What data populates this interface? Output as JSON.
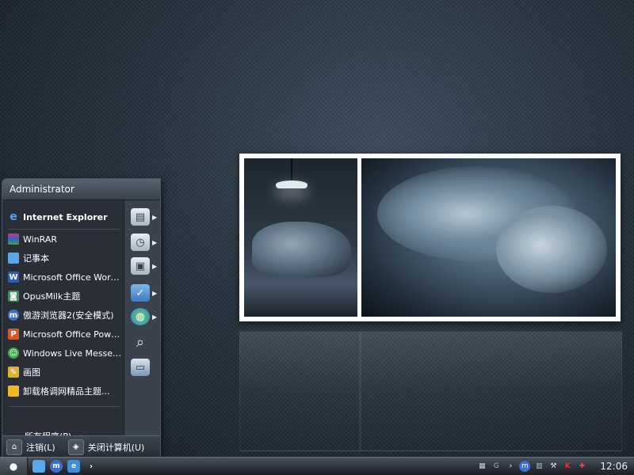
{
  "start_menu": {
    "user_name": "Administrator",
    "programs": [
      {
        "label": "Internet Explorer",
        "icon": "internet-explorer-icon",
        "bold": true
      },
      {
        "label": "WinRAR",
        "icon": "winrar-icon"
      },
      {
        "label": "记事本",
        "icon": "notepad-icon"
      },
      {
        "label": "Microsoft Office Word ...",
        "icon": "word-icon"
      },
      {
        "label": "OpusMilk主题",
        "icon": "opusmilk-icon"
      },
      {
        "label": "傲游浏览器2(安全模式)",
        "icon": "maxthon-icon"
      },
      {
        "label": "Microsoft Office Power...",
        "icon": "powerpoint-icon"
      },
      {
        "label": "Windows Live Messeng...",
        "icon": "messenger-icon"
      },
      {
        "label": "画图",
        "icon": "paint-icon"
      },
      {
        "label": "卸载格调网精品主题...",
        "icon": "uninstall-icon"
      }
    ],
    "all_programs_label": "所有程序(P)",
    "right_items": [
      {
        "icon": "my-documents-icon",
        "has_submenu": true
      },
      {
        "icon": "recent-documents-icon",
        "has_submenu": true
      },
      {
        "icon": "my-pictures-icon",
        "has_submenu": true
      },
      {
        "icon": "control-panel-icon",
        "has_submenu": true
      },
      {
        "icon": "network-icon",
        "has_submenu": true
      },
      {
        "icon": "search-icon",
        "has_submenu": false
      },
      {
        "icon": "run-icon",
        "has_submenu": false
      }
    ],
    "logoff_label": "注销(L)",
    "shutdown_label": "关闭计算机(U)"
  },
  "taskbar": {
    "clock": "12:06",
    "tray_text": "G"
  }
}
